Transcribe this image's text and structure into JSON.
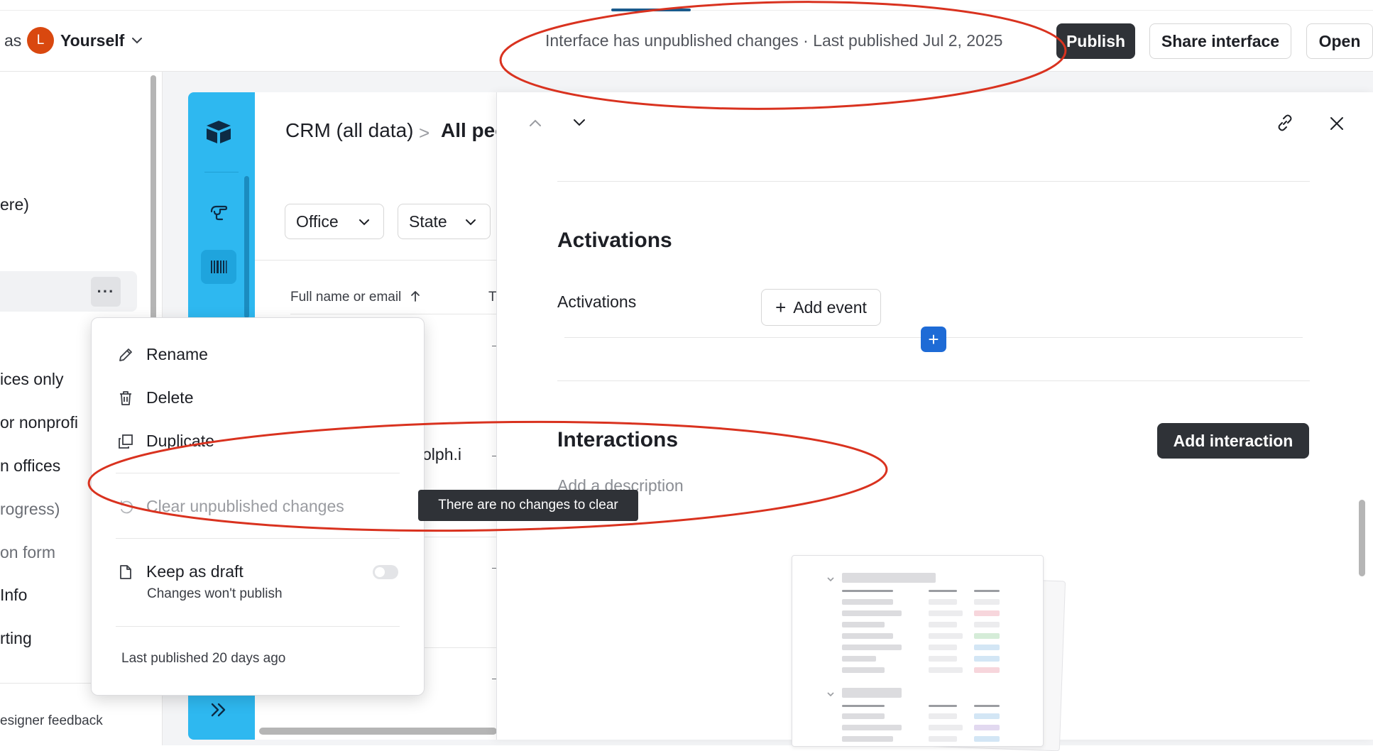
{
  "topbar": {
    "as_label": "as",
    "avatar_initial": "L",
    "viewer_name": "Yourself",
    "status": "Interface has unpublished changes · Last published Jul 2, 2025",
    "publish_label": "Publish",
    "share_label": "Share interface",
    "open_label": "Open"
  },
  "sidebar": {
    "items": [
      {
        "label": "ere)"
      },
      {
        "label": "ices only"
      },
      {
        "label": " or nonprofi"
      },
      {
        "label": "n offices"
      },
      {
        "label": "rogress)"
      },
      {
        "label": "on form"
      },
      {
        "label": "Info"
      },
      {
        "label": "rting"
      }
    ],
    "more_label": "···",
    "feedback": "esigner feedback"
  },
  "content": {
    "breadcrumb_base": "CRM (all data)",
    "breadcrumb_sep": ">",
    "breadcrumb_current": "All people",
    "filters": [
      {
        "label": "Office"
      },
      {
        "label": "State"
      }
    ],
    "column_header": "Full name or email",
    "column_header2": "T",
    "row_partial": "olph.i"
  },
  "detail": {
    "activations_title": "Activations",
    "activations_field": "Activations",
    "add_event_label": "Add event",
    "interactions_title": "Interactions",
    "add_interaction_label": "Add interaction",
    "description_placeholder": "Add a description"
  },
  "menu": {
    "rename": "Rename",
    "delete": "Delete",
    "duplicate": "Duplicate",
    "clear": "Clear unpublished changes",
    "keep_draft": "Keep as draft",
    "keep_draft_sub": "Changes won't publish",
    "keep_draft_on": false,
    "last_published": "Last published 20 days ago"
  },
  "tooltip": "There are no changes to clear",
  "colors": {
    "accent_blue": "#2eb8f0",
    "dark_button": "#2f3237",
    "avatar": "#d9480f",
    "annotation_red": "#d9321f"
  }
}
